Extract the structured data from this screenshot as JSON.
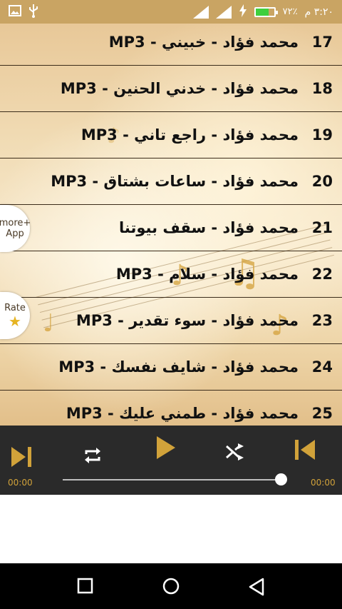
{
  "status_bar": {
    "time": "٣:٢٠ م",
    "battery_percent_label": "٧٢٪",
    "battery_level": 0.72,
    "icons": [
      "image-icon",
      "usb-icon",
      "signal-icon",
      "signal-icon",
      "charging-icon",
      "battery-icon"
    ]
  },
  "tracks": [
    {
      "number": "17",
      "title": "محمد فؤاد - خبيني - MP3"
    },
    {
      "number": "18",
      "title": "محمد فؤاد - خدني الحنين - MP3"
    },
    {
      "number": "19",
      "title": "محمد فؤاد - راجع تاني - MP3"
    },
    {
      "number": "20",
      "title": "محمد فؤاد - ساعات بشتاق - MP3"
    },
    {
      "number": "21",
      "title": "محمد فؤاد - سقف بيوتنا"
    },
    {
      "number": "22",
      "title": "محمد فؤاد - سلام - MP3"
    },
    {
      "number": "23",
      "title": "محمد فؤاد - سوء تقدير - MP3"
    },
    {
      "number": "24",
      "title": "محمد فؤاد - شايف نفسك - MP3"
    },
    {
      "number": "25",
      "title": "محمد فؤاد - طمني عليك - MP3"
    }
  ],
  "side_buttons": {
    "more_app_line1": "more+",
    "more_app_line2": "App",
    "rate_label": "Rate"
  },
  "player": {
    "elapsed": "00:00",
    "duration": "00:00",
    "progress": 1.0,
    "accent_color": "#d1a23a",
    "controls": [
      "skip-next-icon",
      "repeat-icon",
      "play-icon",
      "shuffle-icon",
      "skip-previous-icon"
    ]
  },
  "nav_bar": {
    "icons": [
      "recents-icon",
      "home-icon",
      "back-icon"
    ]
  }
}
